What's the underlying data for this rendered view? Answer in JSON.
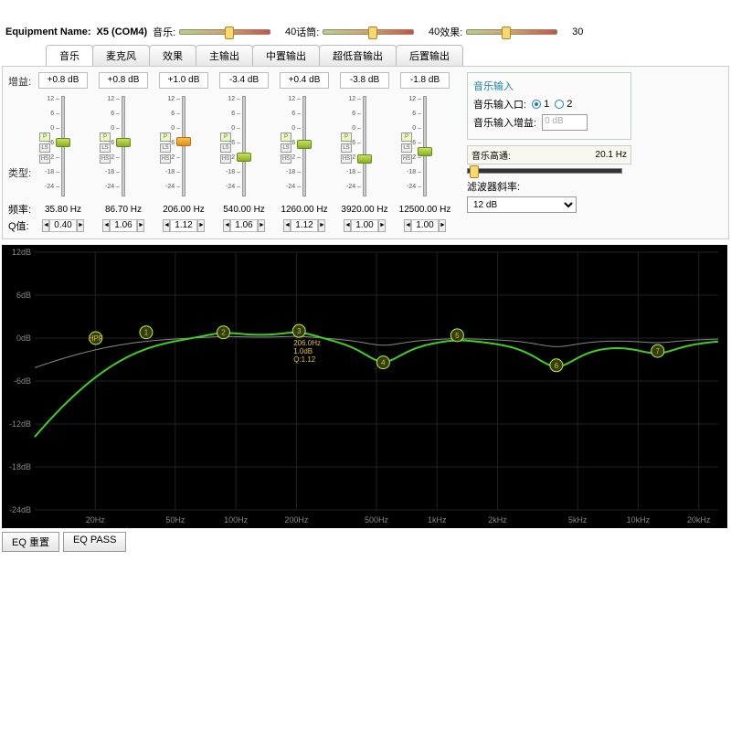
{
  "header": {
    "equipment_label": "Equipment Name:",
    "equipment_value": "X5 (COM4)",
    "sliders": [
      {
        "name": "音乐",
        "value": 40,
        "pos": 50
      },
      {
        "name": "话筒",
        "value": 40,
        "pos": 50
      },
      {
        "name": "效果",
        "value": 30,
        "pos": 38
      }
    ]
  },
  "tabs": [
    "音乐",
    "麦克风",
    "效果",
    "主输出",
    "中置输出",
    "超低音输出",
    "后置输出"
  ],
  "active_tab": 0,
  "row_labels": {
    "gain": "增益:",
    "type": "类型:",
    "freq": "频率:",
    "q": "Q值:"
  },
  "bands": [
    {
      "gain": "+0.8 dB",
      "freq": "35.80 Hz",
      "q": "0.40",
      "knob_pos": 46,
      "color": "green"
    },
    {
      "gain": "+0.8 dB",
      "freq": "86.70 Hz",
      "q": "1.06",
      "knob_pos": 46,
      "color": "green"
    },
    {
      "gain": "+1.0 dB",
      "freq": "206.00 Hz",
      "q": "1.12",
      "knob_pos": 45,
      "color": "orange"
    },
    {
      "gain": "-3.4 dB",
      "freq": "540.00 Hz",
      "q": "1.06",
      "knob_pos": 62,
      "color": "green"
    },
    {
      "gain": "+0.4 dB",
      "freq": "1260.00 Hz",
      "q": "1.12",
      "knob_pos": 48,
      "color": "green"
    },
    {
      "gain": "-3.8 dB",
      "freq": "3920.00 Hz",
      "q": "1.00",
      "knob_pos": 64,
      "color": "green"
    },
    {
      "gain": "-1.8 dB",
      "freq": "12500.00 Hz",
      "q": "1.00",
      "knob_pos": 56,
      "color": "green"
    }
  ],
  "vslider_ticks": [
    "12",
    "6",
    "0",
    "-6",
    "-12",
    "-18",
    "-24"
  ],
  "band_type_buttons": [
    "P",
    "LS",
    "HS"
  ],
  "music_input": {
    "title": "音乐输入",
    "port_label": "音乐输入口:",
    "options": [
      "1",
      "2"
    ],
    "selected": "1",
    "gain_label": "音乐输入增益:",
    "gain_value": "0 dB"
  },
  "highpass": {
    "label": "音乐高通:",
    "value": "20.1 Hz"
  },
  "filter_slope": {
    "label": "滤波器斜率:",
    "value": "12 dB"
  },
  "chart_data": {
    "type": "line",
    "title": "",
    "xlabel": "",
    "ylabel": "",
    "y_ticks": [
      12,
      6,
      0,
      -6,
      -12,
      -18,
      -24
    ],
    "y_tick_labels": [
      "12dB",
      "6dB",
      "0dB",
      "-6dB",
      "-12dB",
      "-18dB",
      "-24dB"
    ],
    "x_ticks": [
      20,
      50,
      100,
      200,
      500,
      1000,
      2000,
      5000,
      10000,
      20000
    ],
    "x_tick_labels": [
      "20Hz",
      "50Hz",
      "100Hz",
      "200Hz",
      "500Hz",
      "1kHz",
      "2kHz",
      "5kHz",
      "10kHz",
      "20kHz"
    ],
    "ylim": [
      -24,
      12
    ],
    "nodes": [
      {
        "id": "HPF",
        "freq": 20.1,
        "db": 0
      },
      {
        "id": "1",
        "freq": 35.8,
        "db": 0.8
      },
      {
        "id": "2",
        "freq": 86.7,
        "db": 0.8
      },
      {
        "id": "3",
        "freq": 206,
        "db": 1.0
      },
      {
        "id": "4",
        "freq": 540,
        "db": -3.4
      },
      {
        "id": "5",
        "freq": 1260,
        "db": 0.4
      },
      {
        "id": "6",
        "freq": 3920,
        "db": -3.8
      },
      {
        "id": "7",
        "freq": 12500,
        "db": -1.8
      }
    ],
    "annotation": {
      "lines": [
        "206.0Hz",
        "1.0dB",
        "Q:1.12"
      ],
      "at_node": 3
    }
  },
  "bottom": {
    "reset": "EQ 重置",
    "pass": "EQ PASS"
  }
}
